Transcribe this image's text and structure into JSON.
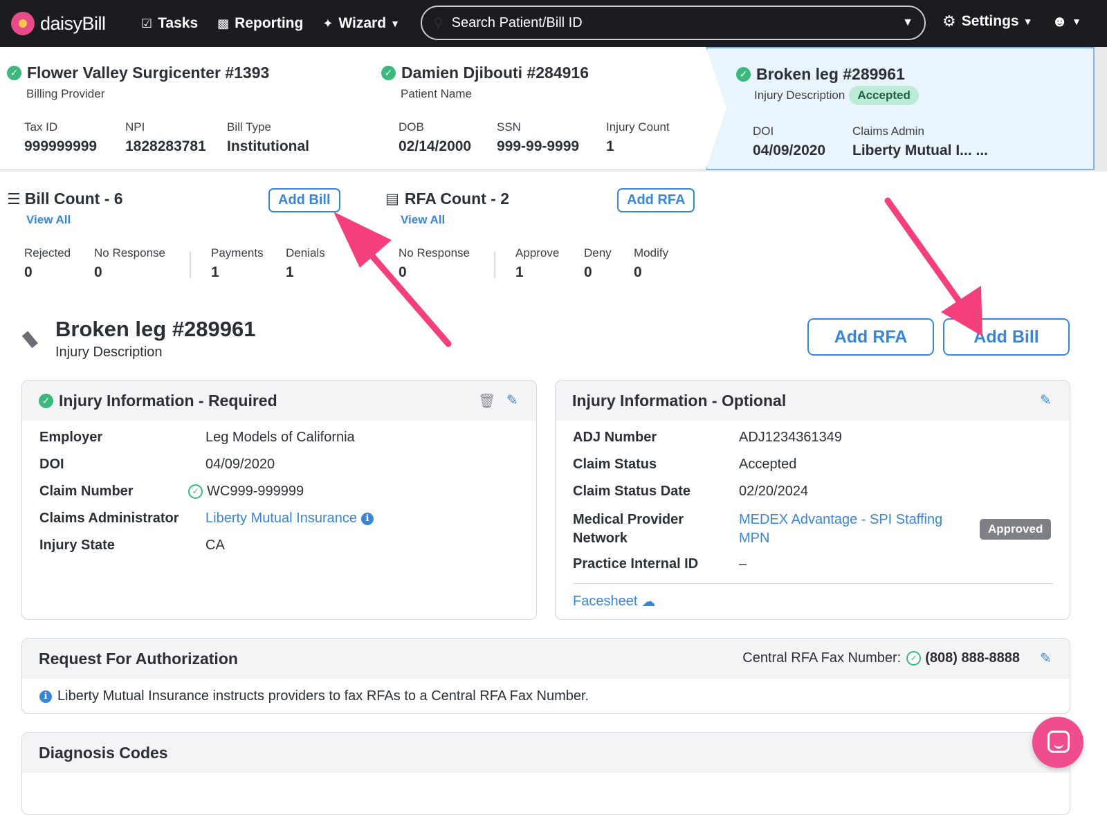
{
  "nav": {
    "logo_text": "daisyBill",
    "tasks": "Tasks",
    "reporting": "Reporting",
    "wizard": "Wizard",
    "search_placeholder": "Search Patient/Bill ID",
    "settings": "Settings"
  },
  "provider": {
    "title": "Flower Valley Surgicenter #1393",
    "subtitle": "Billing Provider",
    "fields": [
      {
        "label": "Tax ID",
        "value": "999999999"
      },
      {
        "label": "NPI",
        "value": "1828283781"
      },
      {
        "label": "Bill Type",
        "value": "Institutional"
      }
    ]
  },
  "patient": {
    "title": "Damien Djibouti #284916",
    "subtitle": "Patient Name",
    "fields": [
      {
        "label": "DOB",
        "value": "02/14/2000"
      },
      {
        "label": "SSN",
        "value": "999-99-9999"
      },
      {
        "label": "Injury Count",
        "value": "1"
      }
    ]
  },
  "injury_card": {
    "title": "Broken leg #289961",
    "subtitle": "Injury Description",
    "badge": "Accepted",
    "fields": [
      {
        "label": "DOI",
        "value": "04/09/2020"
      },
      {
        "label": "Claims Admin",
        "value": "Liberty Mutual I... ..."
      }
    ]
  },
  "bills": {
    "title": "Bill Count - 6",
    "view_all": "View All",
    "add": "Add Bill",
    "stats": [
      {
        "label": "Rejected",
        "value": "0"
      },
      {
        "label": "No Response",
        "value": "0"
      },
      {
        "label": "Payments",
        "value": "1"
      },
      {
        "label": "Denials",
        "value": "1"
      }
    ]
  },
  "rfas": {
    "title": "RFA Count - 2",
    "view_all": "View All",
    "add": "Add RFA",
    "stats": [
      {
        "label": "No Response",
        "value": "0"
      },
      {
        "label": "Approve",
        "value": "1"
      },
      {
        "label": "Deny",
        "value": "0"
      },
      {
        "label": "Modify",
        "value": "0"
      }
    ]
  },
  "page": {
    "title": "Broken leg #289961",
    "subtitle": "Injury Description",
    "add_rfa": "Add RFA",
    "add_bill": "Add Bill"
  },
  "required": {
    "title": "Injury Information - Required",
    "rows": [
      {
        "label": "Employer",
        "value": "Leg Models of California"
      },
      {
        "label": "DOI",
        "value": "04/09/2020"
      },
      {
        "label": "Claim Number",
        "value": "WC999-999999"
      },
      {
        "label": "Claims Administrator",
        "value": "Liberty Mutual Insurance"
      },
      {
        "label": "Injury State",
        "value": "CA"
      }
    ]
  },
  "optional": {
    "title": "Injury Information - Optional",
    "rows": [
      {
        "label": "ADJ Number",
        "value": "ADJ1234361349"
      },
      {
        "label": "Claim Status",
        "value": "Accepted"
      },
      {
        "label": "Claim Status Date",
        "value": "02/20/2024"
      },
      {
        "label": "Medical Provider Network",
        "value": "MEDEX Advantage - SPI Staffing MPN"
      },
      {
        "label": "Practice Internal ID",
        "value": "–"
      }
    ],
    "mpn_badge": "Approved",
    "facesheet": "Facesheet"
  },
  "rfa_section": {
    "title": "Request For Authorization",
    "fax_label": "Central RFA Fax Number:",
    "fax_number": "(808) 888-8888",
    "info": "Liberty Mutual Insurance instructs providers to fax RFAs to a Central RFA Fax Number."
  },
  "diagnosis": {
    "title": "Diagnosis Codes"
  },
  "colors": {
    "accent": "#3a86d6",
    "arrow": "#f43f7c",
    "success": "#3bb97c",
    "topbar": "#1a1c1f"
  }
}
